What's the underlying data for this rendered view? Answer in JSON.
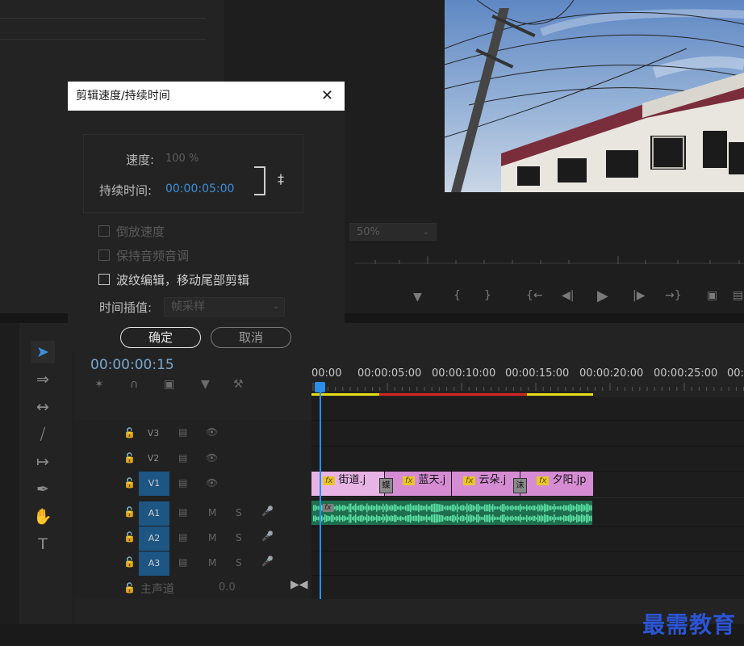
{
  "monitor": {
    "zoom": "50%"
  },
  "dialog": {
    "title": "剪辑速度/持续时间",
    "speed_label": "速度:",
    "speed_value": "100 %",
    "duration_label": "持续时间:",
    "duration_value": "00:00:05:00",
    "reverse_label": "倒放速度",
    "keep_pitch_label": "保持音频音调",
    "ripple_label": "波纹编辑，移动尾部剪辑",
    "interp_label": "时间插值:",
    "interp_value": "帧采样",
    "ok_label": "确定",
    "cancel_label": "取消"
  },
  "timeline": {
    "timecode": "00:00:00:15",
    "ruler": [
      "00:00",
      "00:00:05:00",
      "00:00:10:00",
      "00:00:15:00",
      "00:00:20:00",
      "00:00:25:00",
      "00:"
    ],
    "tracks": {
      "v3": "V3",
      "v2": "V2",
      "v1": "V1",
      "a1": "A1",
      "a2": "A2",
      "a3": "A3",
      "mute": "M",
      "solo": "S"
    },
    "master_label": "主声道",
    "master_value": "0.0",
    "clips": [
      {
        "name": "街道.j",
        "fx": "fx"
      },
      {
        "name": "蓝天.j",
        "fx": "fx"
      },
      {
        "name": "云朵.j",
        "fx": "fx"
      },
      {
        "name": "夕阳.jp",
        "fx": "fx"
      }
    ],
    "transitions": [
      "蝶",
      "沫"
    ],
    "audio_fx": "fx"
  },
  "watermark": "最需教育",
  "colors": {
    "accent": "#2d8ee8",
    "track_on": "#1d5583",
    "clip": "#d58cd3",
    "audio": "#1f6e4e",
    "fx": "#e8c62a",
    "watermark": "#2b54d6"
  }
}
